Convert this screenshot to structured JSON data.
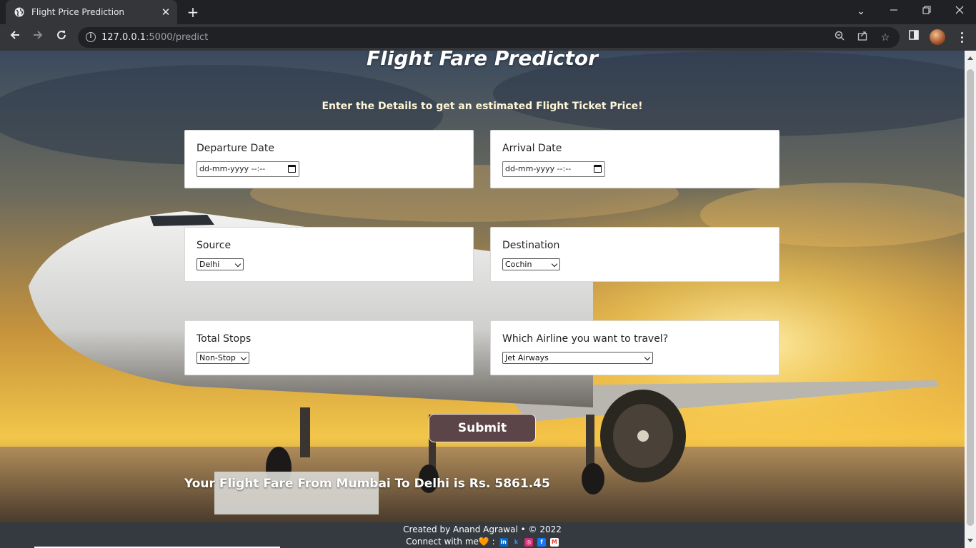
{
  "browser": {
    "tab_title": "Flight Price Prediction",
    "url_host": "127.0.0.1",
    "url_rest": ":5000/predict"
  },
  "page": {
    "title": "Flight Fare Predictor",
    "subtitle": "Enter the Details to get an estimated Flight Ticket Price!",
    "departure": {
      "label": "Departure Date",
      "value": "dd-mm-yyyy --:--"
    },
    "arrival": {
      "label": "Arrival Date",
      "value": "dd-mm-yyyy --:--"
    },
    "source": {
      "label": "Source",
      "selected": "Delhi"
    },
    "destination": {
      "label": "Destination",
      "selected": "Cochin"
    },
    "stops": {
      "label": "Total Stops",
      "selected": "Non-Stop"
    },
    "airline": {
      "label": "Which Airline you want to travel?",
      "selected": "Jet Airways"
    },
    "submit_label": "Submit",
    "result_text": "Your Flight Fare From Mumbai To Delhi is Rs. 5861.45"
  },
  "footer": {
    "credit": "Created by Anand Agrawal • © 2022",
    "connect": "Connect with me🧡 :"
  },
  "colors": {
    "submit_bg": "#5c4549",
    "footer_bg": "#343a40",
    "chrome_dark": "#202124",
    "chrome_toolbar": "#35363a"
  }
}
